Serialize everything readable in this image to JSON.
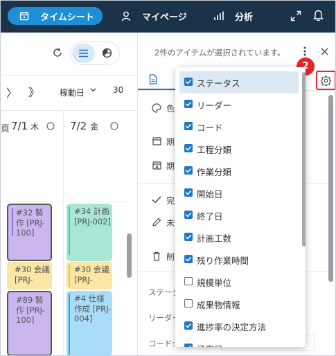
{
  "topbar": {
    "tabs": [
      {
        "label": "タイムシート",
        "icon": "calendar-icon",
        "active": true
      },
      {
        "label": "マイページ",
        "icon": "person-icon"
      },
      {
        "label": "分析",
        "icon": "bar-chart-icon"
      }
    ],
    "icons": [
      "expand-icon",
      "bell-icon"
    ]
  },
  "left": {
    "view_icons": [
      "refresh-icon",
      "list-view-icon",
      "pie-chart-icon"
    ],
    "nav": {
      "next": "〉",
      "fast_next": "》",
      "period_label": "稼動日",
      "zoom": "30"
    },
    "days": [
      {
        "partial": "",
        "date": "7/1",
        "weekday": "木"
      },
      {
        "date": "7/2",
        "weekday": "金"
      }
    ],
    "tasks": [
      {
        "text": "#32 製作 [PRJ-100]",
        "color": "#cbb6f0",
        "accent": "#8a6fd6"
      },
      {
        "text": "#34 計画 [PRJ-002]",
        "color": "#a9e6d6",
        "accent": "#3cc9a6"
      },
      {
        "text": "#30 会議 [PRJ-",
        "color": "#fbe6a3",
        "accent": "#f0c330"
      },
      {
        "text": "#30 会議 [PRJ-",
        "color": "#fbe6a3",
        "accent": "#f0c330"
      },
      {
        "text": "#89 製作 [PRJ-100]",
        "color": "#cbb6f0",
        "accent": "#8a6fd6"
      },
      {
        "text": "#4 仕様作成 [PRJ-004]",
        "color": "#a9dcf7",
        "accent": "#27a6e6"
      }
    ]
  },
  "right": {
    "selection_text": "2件のアイテムが選択されています。",
    "badge": "2",
    "side_labels": [
      "色",
      "期",
      "期",
      "完",
      "未",
      "削"
    ],
    "form_labels": [
      "ステータ",
      "リーダー",
      "コード:"
    ]
  },
  "column_menu": {
    "items": [
      {
        "label": "ステータス",
        "checked": true,
        "highlight": true
      },
      {
        "label": "リーダー",
        "checked": true
      },
      {
        "label": "コード",
        "checked": true
      },
      {
        "label": "工程分類",
        "checked": true
      },
      {
        "label": "作業分類",
        "checked": true
      },
      {
        "label": "開始日",
        "checked": true
      },
      {
        "label": "終了日",
        "checked": true
      },
      {
        "label": "計画工数",
        "checked": true
      },
      {
        "label": "残り作業時間",
        "checked": true
      },
      {
        "label": "規模単位",
        "checked": false
      },
      {
        "label": "成果物情報",
        "checked": false
      },
      {
        "label": "進捗率の決定方法",
        "checked": true
      },
      {
        "label": "予定日",
        "checked": true
      }
    ]
  },
  "colors": {
    "topbar": "#1a3348",
    "accent": "#1d8fd6",
    "badge": "#e3262b",
    "checkbox": "#1c78c8"
  }
}
